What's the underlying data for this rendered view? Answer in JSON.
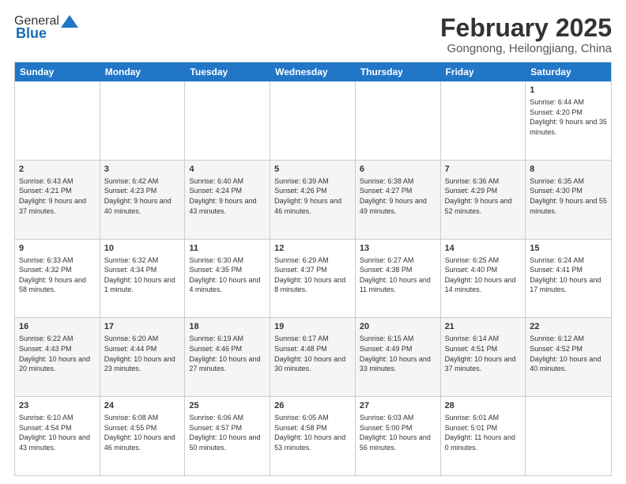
{
  "header": {
    "logo_general": "General",
    "logo_blue": "Blue",
    "month_year": "February 2025",
    "location": "Gongnong, Heilongjiang, China"
  },
  "days_of_week": [
    "Sunday",
    "Monday",
    "Tuesday",
    "Wednesday",
    "Thursday",
    "Friday",
    "Saturday"
  ],
  "weeks": [
    [
      {
        "day": "",
        "detail": ""
      },
      {
        "day": "",
        "detail": ""
      },
      {
        "day": "",
        "detail": ""
      },
      {
        "day": "",
        "detail": ""
      },
      {
        "day": "",
        "detail": ""
      },
      {
        "day": "",
        "detail": ""
      },
      {
        "day": "1",
        "detail": "Sunrise: 6:44 AM\nSunset: 4:20 PM\nDaylight: 9 hours and 35 minutes."
      }
    ],
    [
      {
        "day": "2",
        "detail": "Sunrise: 6:43 AM\nSunset: 4:21 PM\nDaylight: 9 hours and 37 minutes."
      },
      {
        "day": "3",
        "detail": "Sunrise: 6:42 AM\nSunset: 4:23 PM\nDaylight: 9 hours and 40 minutes."
      },
      {
        "day": "4",
        "detail": "Sunrise: 6:40 AM\nSunset: 4:24 PM\nDaylight: 9 hours and 43 minutes."
      },
      {
        "day": "5",
        "detail": "Sunrise: 6:39 AM\nSunset: 4:26 PM\nDaylight: 9 hours and 46 minutes."
      },
      {
        "day": "6",
        "detail": "Sunrise: 6:38 AM\nSunset: 4:27 PM\nDaylight: 9 hours and 49 minutes."
      },
      {
        "day": "7",
        "detail": "Sunrise: 6:36 AM\nSunset: 4:29 PM\nDaylight: 9 hours and 52 minutes."
      },
      {
        "day": "8",
        "detail": "Sunrise: 6:35 AM\nSunset: 4:30 PM\nDaylight: 9 hours and 55 minutes."
      }
    ],
    [
      {
        "day": "9",
        "detail": "Sunrise: 6:33 AM\nSunset: 4:32 PM\nDaylight: 9 hours and 58 minutes."
      },
      {
        "day": "10",
        "detail": "Sunrise: 6:32 AM\nSunset: 4:34 PM\nDaylight: 10 hours and 1 minute."
      },
      {
        "day": "11",
        "detail": "Sunrise: 6:30 AM\nSunset: 4:35 PM\nDaylight: 10 hours and 4 minutes."
      },
      {
        "day": "12",
        "detail": "Sunrise: 6:29 AM\nSunset: 4:37 PM\nDaylight: 10 hours and 8 minutes."
      },
      {
        "day": "13",
        "detail": "Sunrise: 6:27 AM\nSunset: 4:38 PM\nDaylight: 10 hours and 11 minutes."
      },
      {
        "day": "14",
        "detail": "Sunrise: 6:25 AM\nSunset: 4:40 PM\nDaylight: 10 hours and 14 minutes."
      },
      {
        "day": "15",
        "detail": "Sunrise: 6:24 AM\nSunset: 4:41 PM\nDaylight: 10 hours and 17 minutes."
      }
    ],
    [
      {
        "day": "16",
        "detail": "Sunrise: 6:22 AM\nSunset: 4:43 PM\nDaylight: 10 hours and 20 minutes."
      },
      {
        "day": "17",
        "detail": "Sunrise: 6:20 AM\nSunset: 4:44 PM\nDaylight: 10 hours and 23 minutes."
      },
      {
        "day": "18",
        "detail": "Sunrise: 6:19 AM\nSunset: 4:46 PM\nDaylight: 10 hours and 27 minutes."
      },
      {
        "day": "19",
        "detail": "Sunrise: 6:17 AM\nSunset: 4:48 PM\nDaylight: 10 hours and 30 minutes."
      },
      {
        "day": "20",
        "detail": "Sunrise: 6:15 AM\nSunset: 4:49 PM\nDaylight: 10 hours and 33 minutes."
      },
      {
        "day": "21",
        "detail": "Sunrise: 6:14 AM\nSunset: 4:51 PM\nDaylight: 10 hours and 37 minutes."
      },
      {
        "day": "22",
        "detail": "Sunrise: 6:12 AM\nSunset: 4:52 PM\nDaylight: 10 hours and 40 minutes."
      }
    ],
    [
      {
        "day": "23",
        "detail": "Sunrise: 6:10 AM\nSunset: 4:54 PM\nDaylight: 10 hours and 43 minutes."
      },
      {
        "day": "24",
        "detail": "Sunrise: 6:08 AM\nSunset: 4:55 PM\nDaylight: 10 hours and 46 minutes."
      },
      {
        "day": "25",
        "detail": "Sunrise: 6:06 AM\nSunset: 4:57 PM\nDaylight: 10 hours and 50 minutes."
      },
      {
        "day": "26",
        "detail": "Sunrise: 6:05 AM\nSunset: 4:58 PM\nDaylight: 10 hours and 53 minutes."
      },
      {
        "day": "27",
        "detail": "Sunrise: 6:03 AM\nSunset: 5:00 PM\nDaylight: 10 hours and 56 minutes."
      },
      {
        "day": "28",
        "detail": "Sunrise: 6:01 AM\nSunset: 5:01 PM\nDaylight: 11 hours and 0 minutes."
      },
      {
        "day": "",
        "detail": ""
      }
    ]
  ]
}
